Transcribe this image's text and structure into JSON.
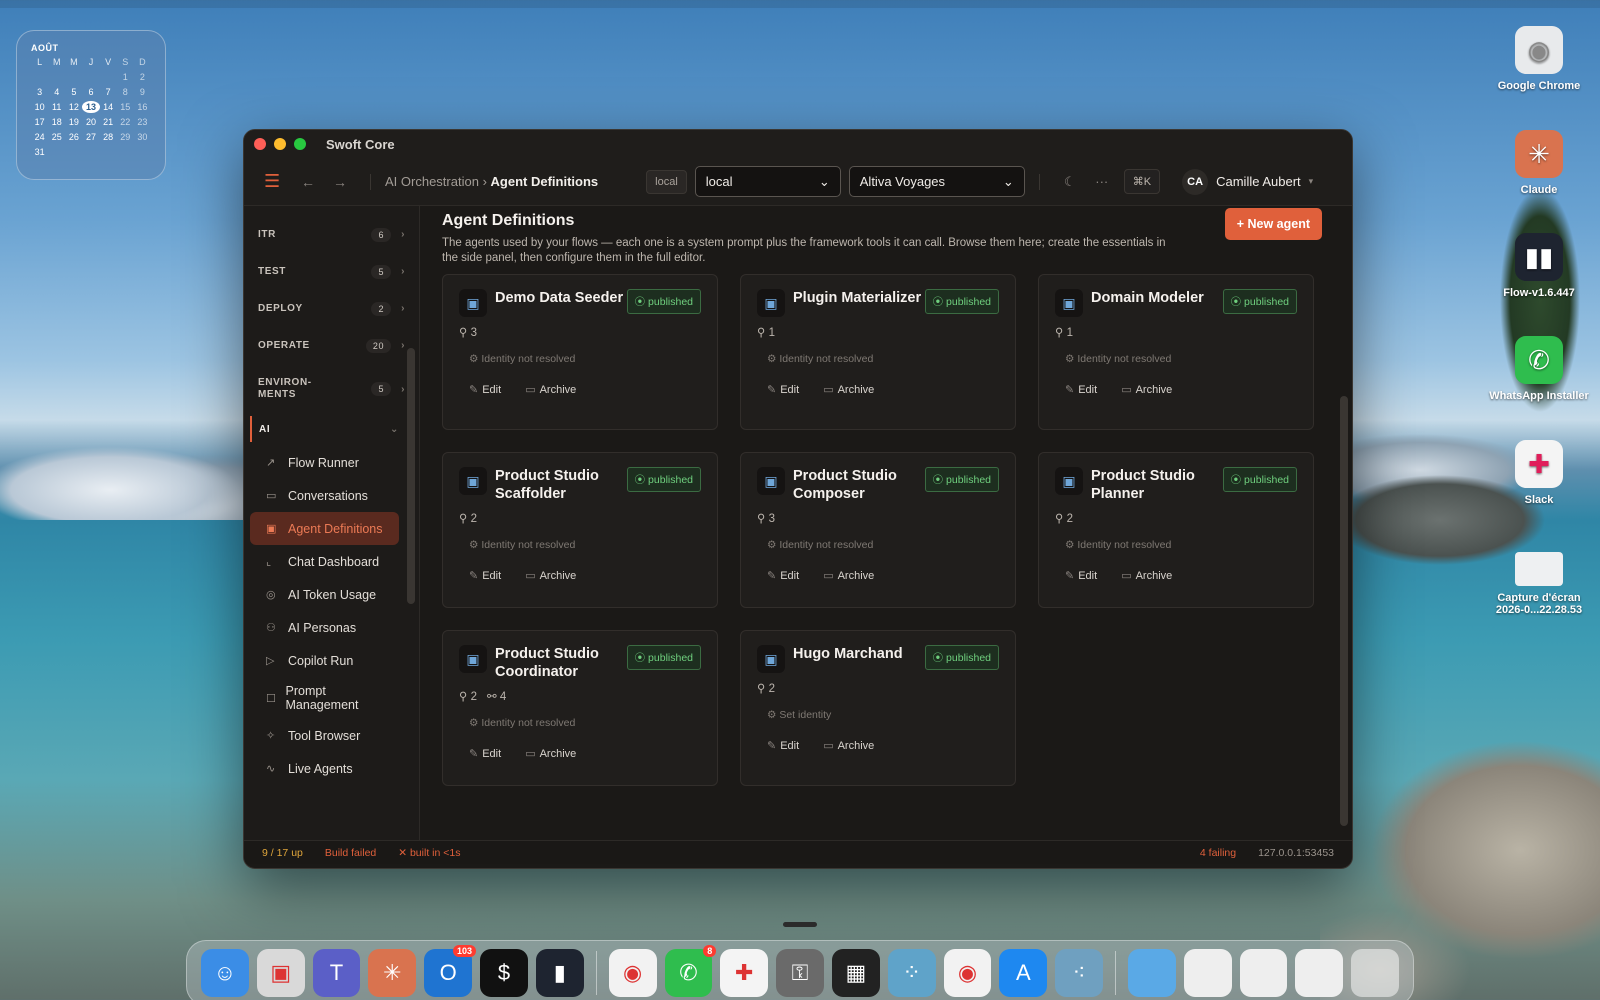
{
  "calendar": {
    "month": "AOÛT",
    "weekdays": [
      "L",
      "M",
      "M",
      "J",
      "V",
      "S",
      "D"
    ],
    "weeks": [
      [
        "",
        "",
        "",
        "",
        "",
        "1",
        "2"
      ],
      [
        "3",
        "4",
        "5",
        "6",
        "7",
        "8",
        "9"
      ],
      [
        "10",
        "11",
        "12",
        "13",
        "14",
        "15",
        "16"
      ],
      [
        "17",
        "18",
        "19",
        "20",
        "21",
        "22",
        "23"
      ],
      [
        "24",
        "25",
        "26",
        "27",
        "28",
        "29",
        "30"
      ],
      [
        "31",
        "",
        "",
        "",
        "",
        "",
        ""
      ]
    ],
    "today": "13"
  },
  "desktop_icons": [
    {
      "label": "Google Chrome",
      "icon": "chrome-icon"
    },
    {
      "label": "Claude",
      "icon": "claude-icon"
    },
    {
      "label": "Flow-v1.6.447",
      "icon": "flow-icon"
    },
    {
      "label": "WhatsApp Installer",
      "icon": "whatsapp-icon"
    },
    {
      "label": "Slack",
      "icon": "slack-icon"
    },
    {
      "label": "Capture d'écran 2026-0...22.28.53",
      "icon": "screenshot-file-icon"
    }
  ],
  "window": {
    "title": "Swoft Core"
  },
  "toolbar": {
    "breadcrumb_parent": "AI Orchestration",
    "breadcrumb_sep": "›",
    "breadcrumb_current": "Agent Definitions",
    "env_tag": "local",
    "env_select": "local",
    "org_select": "Altiva Voyages",
    "shortcut": "⌘K",
    "user_initials": "CA",
    "user_name": "Camille Aubert"
  },
  "sidebar": {
    "sections": [
      {
        "label": "ITR",
        "count": "6"
      },
      {
        "label": "TEST",
        "count": "5"
      },
      {
        "label": "DEPLOY",
        "count": "2"
      },
      {
        "label": "OPERATE",
        "count": "20"
      },
      {
        "label": "ENVIRON-\nMENTS",
        "count": "5"
      }
    ],
    "ai_label": "AI",
    "items": [
      {
        "label": "Flow Runner",
        "icon": "flow-runner-icon"
      },
      {
        "label": "Conversations",
        "icon": "conversations-icon"
      },
      {
        "label": "Agent Definitions",
        "icon": "agent-icon",
        "active": true
      },
      {
        "label": "Chat Dashboard",
        "icon": "chart-icon"
      },
      {
        "label": "AI Token Usage",
        "icon": "token-icon"
      },
      {
        "label": "AI Personas",
        "icon": "personas-icon"
      },
      {
        "label": "Copilot Run",
        "icon": "play-icon"
      },
      {
        "label": "Prompt Management",
        "icon": "prompt-icon"
      },
      {
        "label": "Tool Browser",
        "icon": "tool-icon"
      },
      {
        "label": "Live Agents",
        "icon": "pulse-icon"
      }
    ]
  },
  "main": {
    "title": "Agent Definitions",
    "description": "The agents used by your flows — each one is a system prompt plus the framework tools it can call. Browse them here; create the essentials in the side panel, then configure them in the full editor.",
    "new_button": "+ New agent",
    "edit_label": "Edit",
    "archive_label": "Archive",
    "cards": [
      {
        "name": "Demo Data Seeder",
        "status": "published",
        "tools": "3",
        "links": "",
        "identity": "Identity not resolved"
      },
      {
        "name": "Plugin Materializer",
        "status": "published",
        "tools": "1",
        "links": "",
        "identity": "Identity not resolved"
      },
      {
        "name": "Domain Modeler",
        "status": "published",
        "tools": "1",
        "links": "",
        "identity": "Identity not resolved"
      },
      {
        "name": "Product Studio Scaffolder",
        "status": "published",
        "tools": "2",
        "links": "",
        "identity": "Identity not resolved"
      },
      {
        "name": "Product Studio Composer",
        "status": "published",
        "tools": "3",
        "links": "",
        "identity": "Identity not resolved"
      },
      {
        "name": "Product Studio Planner",
        "status": "published",
        "tools": "2",
        "links": "",
        "identity": "Identity not resolved"
      },
      {
        "name": "Product Studio Coordinator",
        "status": "published",
        "tools": "2",
        "links": "4",
        "identity": "Identity not resolved"
      },
      {
        "name": "Hugo Marchand",
        "status": "published",
        "tools": "2",
        "links": "",
        "identity": "Set identity"
      }
    ]
  },
  "statusbar": {
    "up": "9 / 17 up",
    "build": "Build failed",
    "built": "built in <1s",
    "failing": "4 failing",
    "address": "127.0.0.1:53453"
  },
  "dock": {
    "apps": [
      {
        "name": "finder-icon",
        "badge": ""
      },
      {
        "name": "screenshot-icon",
        "badge": ""
      },
      {
        "name": "teams-icon",
        "badge": ""
      },
      {
        "name": "claude-icon",
        "badge": ""
      },
      {
        "name": "outlook-icon",
        "badge": "103"
      },
      {
        "name": "terminal-icon",
        "badge": ""
      },
      {
        "name": "flow-icon",
        "badge": ""
      },
      {
        "name": "chrome-icon",
        "badge": ""
      },
      {
        "name": "whatsapp-icon",
        "badge": "8"
      },
      {
        "name": "slack-icon",
        "badge": ""
      },
      {
        "name": "keychain-icon",
        "badge": ""
      },
      {
        "name": "intellij-icon",
        "badge": ""
      },
      {
        "name": "linear-icon",
        "badge": ""
      },
      {
        "name": "chrome-alt-icon",
        "badge": ""
      },
      {
        "name": "app-store-icon",
        "badge": ""
      },
      {
        "name": "dots-icon",
        "badge": ""
      }
    ]
  },
  "colors": {
    "accent": "#e0603b",
    "published": "#6fcf7e",
    "window_bg": "#1b1917"
  }
}
